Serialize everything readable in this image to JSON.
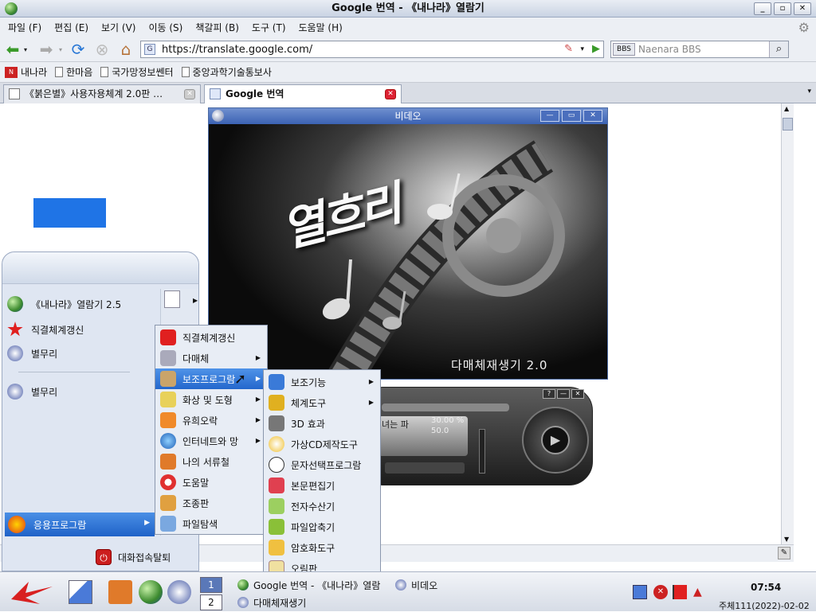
{
  "window": {
    "title": "Google 번역 - 《내나라》열람기"
  },
  "menubar": [
    "파일 (F)",
    "편집 (E)",
    "보기 (V)",
    "이동 (S)",
    "책갈피 (B)",
    "도구 (T)",
    "도움말 (H)"
  ],
  "address": {
    "url": "https://translate.google.com/",
    "search_engine": "BBS",
    "search_placeholder": "Naenara BBS"
  },
  "bookmarks": [
    "내나라",
    "한마음",
    "국가망정보쎈터",
    "중앙과학기술통보사"
  ],
  "tabs": [
    {
      "label": "《붉은별》사용자용체계 2.0판 …",
      "active": false
    },
    {
      "label": "Google 번역",
      "active": true
    }
  ],
  "video": {
    "title": "비데오",
    "caption": "다매체재생기 2.0",
    "logo": "열흐리"
  },
  "player": {
    "text": "녀는 파",
    "pct1": "30.00 %",
    "pct2": "50.0"
  },
  "start_menu": {
    "items": [
      "《내나라》열람기 2.5",
      "직결체계갱신",
      "별무리",
      "별무리"
    ],
    "apps_label": "응용프로그람",
    "logout_label": "대화접속탈퇴"
  },
  "submenu1": [
    {
      "label": "직결체계갱신",
      "sub": false
    },
    {
      "label": "다매체",
      "sub": true
    },
    {
      "label": "보조프로그람",
      "sub": true
    },
    {
      "label": "화상 및 도형",
      "sub": true
    },
    {
      "label": "유희오락",
      "sub": true
    },
    {
      "label": "인터네트와 망",
      "sub": true
    },
    {
      "label": "나의 서류철",
      "sub": false
    },
    {
      "label": "도움말",
      "sub": false
    },
    {
      "label": "조종판",
      "sub": false
    },
    {
      "label": "파일탐색",
      "sub": false
    }
  ],
  "submenu2": [
    {
      "label": "보조기능",
      "sub": true
    },
    {
      "label": "체계도구",
      "sub": true
    },
    {
      "label": "3D 효과",
      "sub": false
    },
    {
      "label": "가상CD제작도구",
      "sub": false
    },
    {
      "label": "문자선택프로그람",
      "sub": false
    },
    {
      "label": "본문편집기",
      "sub": false
    },
    {
      "label": "전자수산기",
      "sub": false
    },
    {
      "label": "파일압축기",
      "sub": false
    },
    {
      "label": "암호화도구",
      "sub": false
    },
    {
      "label": "오림판",
      "sub": false
    }
  ],
  "taskbar": {
    "pagers": [
      "1",
      "2"
    ],
    "tasks": [
      "Google 번역 - 《내나라》열람",
      "비데오",
      "다매체재생기"
    ],
    "clock": "07:54",
    "date": "주체111(2022)-02-02"
  },
  "colors": {
    "accent": "#2467cc",
    "title_bar": "#3b62b3"
  }
}
